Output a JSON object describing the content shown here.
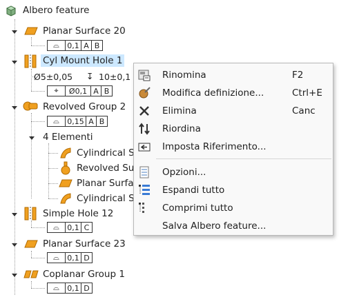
{
  "tree": {
    "root": {
      "label": "Albero feature",
      "icon": "part-icon"
    },
    "planar1": {
      "label": "Planar Surface 20",
      "fcf": [
        "⌓",
        "0,1",
        "A",
        "B"
      ]
    },
    "cylhole": {
      "label": "Cyl Mount Hole 1",
      "dim1": "Ø5±0,05",
      "dim2_symbol": "↧",
      "dim2": "10±0,1",
      "fcf": [
        "⌖",
        "Ø0,1",
        "A",
        "B"
      ]
    },
    "revgroup": {
      "label": "Revolved Group 2",
      "fcf": [
        "⌓",
        "0,15",
        "A",
        "B"
      ],
      "sub": {
        "label": "4 Elementi",
        "items": [
          "Cylindrical S",
          "Revolved Su",
          "Planar Surfac",
          "Cylindrical S"
        ]
      }
    },
    "simplehole": {
      "label": "Simple Hole 12",
      "fcf": [
        "⌓",
        "0,1",
        "C"
      ]
    },
    "planar2": {
      "label": "Planar Surface 23",
      "fcf": [
        "⌓",
        "0,1",
        "D"
      ]
    },
    "coplanar": {
      "label": "Coplanar Group 1",
      "fcf": [
        "⌓",
        "0,1",
        "D"
      ]
    }
  },
  "menu": {
    "items": [
      {
        "label": "Rinomina",
        "shortcut": "F2",
        "icon": "rename-icon"
      },
      {
        "label": "Modifica definizione...",
        "shortcut": "Ctrl+E",
        "icon": "edit-definition-icon"
      },
      {
        "label": "Elimina",
        "shortcut": "Canc",
        "icon": "delete-icon"
      },
      {
        "label": "Riordina",
        "shortcut": "",
        "icon": "reorder-icon"
      },
      {
        "label": "Imposta Riferimento...",
        "shortcut": "",
        "icon": "set-reference-icon"
      },
      {
        "label": "Opzioni...",
        "shortcut": "",
        "icon": "options-icon"
      },
      {
        "label": "Espandi tutto",
        "shortcut": "",
        "icon": "expand-all-icon"
      },
      {
        "label": "Comprimi tutto",
        "shortcut": "",
        "icon": "collapse-all-icon"
      },
      {
        "label": "Salva Albero feature...",
        "shortcut": "",
        "icon": "save-tree-icon"
      }
    ]
  },
  "colors": {
    "selection": "#cce8ff",
    "feature_orange": "#f0a020",
    "menu_bg": "#f9f9f9"
  }
}
